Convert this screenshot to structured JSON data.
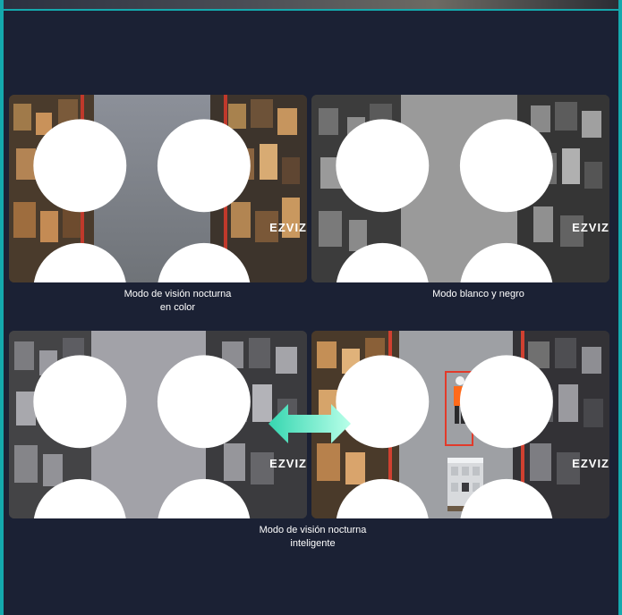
{
  "brand": {
    "logo_text": "EZVIZ"
  },
  "panels": [
    {
      "id": "color",
      "caption": [
        "Modo de visión nocturna",
        "en color"
      ],
      "mode": "color"
    },
    {
      "id": "bw",
      "caption": [
        "Modo blanco y negro"
      ],
      "mode": "bw"
    },
    {
      "id": "gray",
      "caption": [
        "Modo de visión nocturna",
        "inteligente"
      ],
      "mode": "gray"
    },
    {
      "id": "smart",
      "caption": [],
      "mode": "smart"
    }
  ],
  "colors": {
    "background": "#1b2134",
    "frame": "#14a9ad",
    "arrow_start": "#36d6b0",
    "arrow_end": "#b8ffe9",
    "detection_box": "#e23a2a",
    "worker_vest": "#ff6a1a"
  },
  "icons": {
    "transition": "double-arrow-icon",
    "logo": "ezviz-logo-icon"
  }
}
